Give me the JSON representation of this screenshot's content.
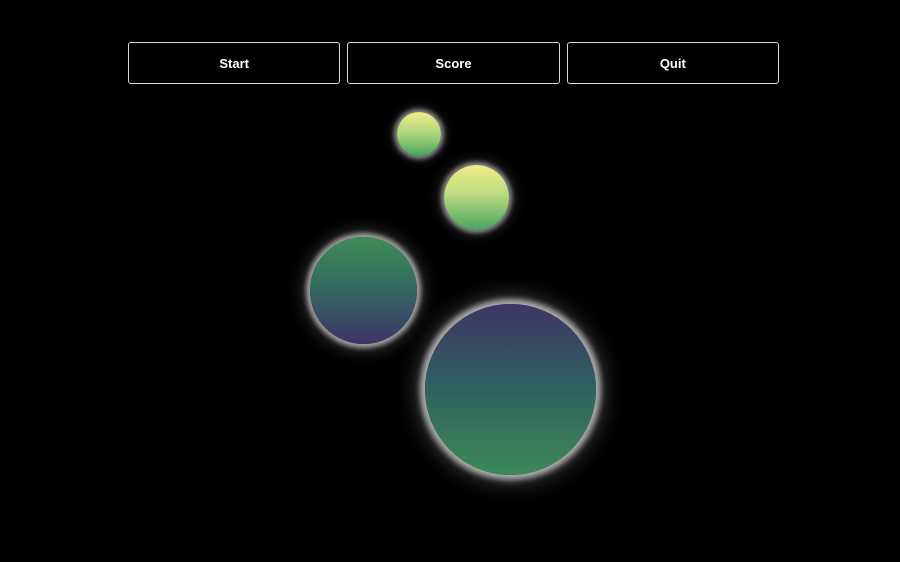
{
  "menu": {
    "start_label": "Start",
    "score_label": "Score",
    "quit_label": "Quit"
  },
  "orbs": [
    {
      "name": "orb-small-yellow-green",
      "colors": [
        "#f3ec8a",
        "#46a35c"
      ]
    },
    {
      "name": "orb-medium-yellow-green",
      "colors": [
        "#f1ec88",
        "#4aa462"
      ]
    },
    {
      "name": "orb-large-green-purple",
      "colors": [
        "#3f8d58",
        "#3d3567"
      ]
    },
    {
      "name": "orb-xlarge-purple-green",
      "colors": [
        "#3f3566",
        "#3c8a57"
      ]
    }
  ],
  "theme": {
    "background": "#000000",
    "button_border": "#d9d9d9",
    "button_text": "#ffffff"
  }
}
